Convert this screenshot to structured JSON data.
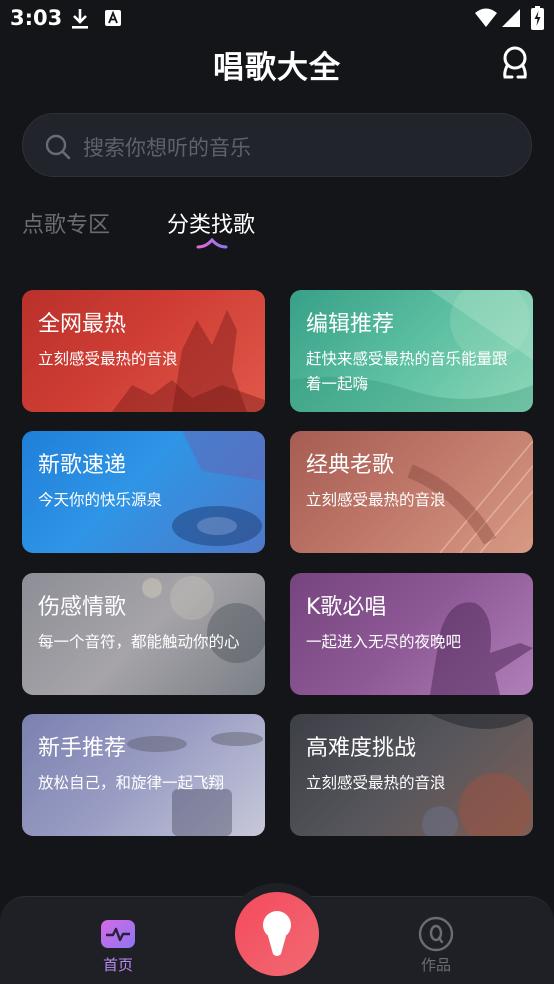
{
  "status_bar": {
    "time": "3:03"
  },
  "header": {
    "title": "唱歌大全"
  },
  "search": {
    "placeholder": "搜索你想听的音乐"
  },
  "tabs": [
    {
      "label": "点歌专区",
      "selected": false
    },
    {
      "label": "分类找歌",
      "selected": true
    }
  ],
  "categories": [
    {
      "title": "全网最热",
      "subtitle": "立刻感受最热的音浪"
    },
    {
      "title": "编辑推荐",
      "subtitle": "赶快来感受最热的音乐能量跟着一起嗨"
    },
    {
      "title": "新歌速递",
      "subtitle": "今天你的快乐源泉"
    },
    {
      "title": "经典老歌",
      "subtitle": "立刻感受最热的音浪"
    },
    {
      "title": "伤感情歌",
      "subtitle": "每一个音符，都能触动你的心"
    },
    {
      "title": "K歌必唱",
      "subtitle": "一起进入无尽的夜晚吧"
    },
    {
      "title": "新手推荐",
      "subtitle": "放松自己，和旋律一起飞翔"
    },
    {
      "title": "高难度挑战",
      "subtitle": "立刻感受最热的音浪"
    }
  ],
  "bottom_nav": {
    "home": {
      "label": "首页",
      "icon": "pulse-icon",
      "active": true
    },
    "record": {
      "icon": "microphone-icon"
    },
    "works": {
      "label": "作品",
      "icon": "disc-icon",
      "active": false
    }
  },
  "colors": {
    "background": "#141519",
    "accent": "#b78cf0",
    "record_button": "#f54a5e"
  }
}
